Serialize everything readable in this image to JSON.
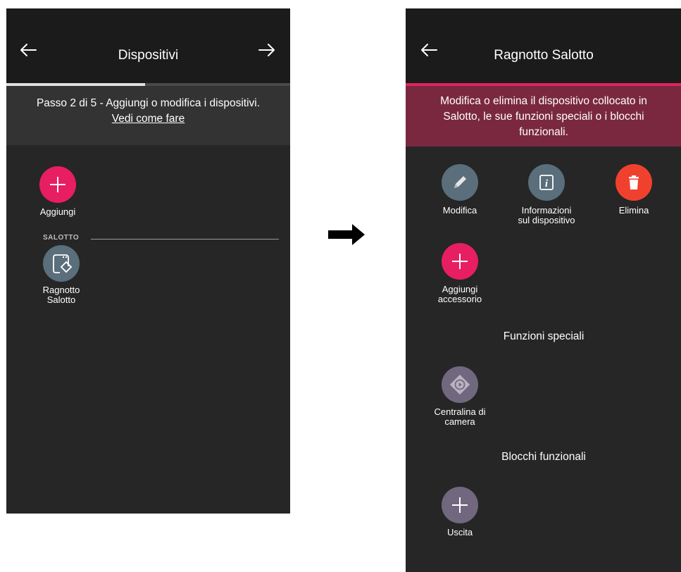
{
  "left_screen": {
    "title": "Dispositivi",
    "progress_fraction": 0.49,
    "step_text": "Passo 2 di 5 - Aggiungi o modifica i dispositivi.",
    "help_link": "Vedi come fare",
    "add_label": "Aggiungi",
    "section_label": "SALOTTO",
    "device_label_line1": "Ragnotto",
    "device_label_line2": "Salotto"
  },
  "right_screen": {
    "title": "Ragnotto Salotto",
    "info_line1": "Modifica o elimina il dispositivo collocato in",
    "info_line2": "Salotto, le sue funzioni speciali o i blocchi",
    "info_line3": "funzionali.",
    "actions": {
      "modifica": "Modifica",
      "info_line1": "Informazioni",
      "info_line2": "sul dispositivo",
      "elimina": "Elimina"
    },
    "add_accessory_line1": "Aggiungi",
    "add_accessory_line2": "accessorio",
    "special_functions_title": "Funzioni speciali",
    "camera_label_line1": "Centralina di",
    "camera_label_line2": "camera",
    "functional_blocks_title": "Blocchi funzionali",
    "output_label": "Uscita"
  },
  "colors": {
    "screen_bg": "#262626",
    "topbar_bg": "#1b1b1b",
    "accent_pink": "#e81e62",
    "info_banner": "#7a2840",
    "delete_red": "#f0412f",
    "icon_slate": "#5a6e7c",
    "icon_purple": "#71687f"
  }
}
